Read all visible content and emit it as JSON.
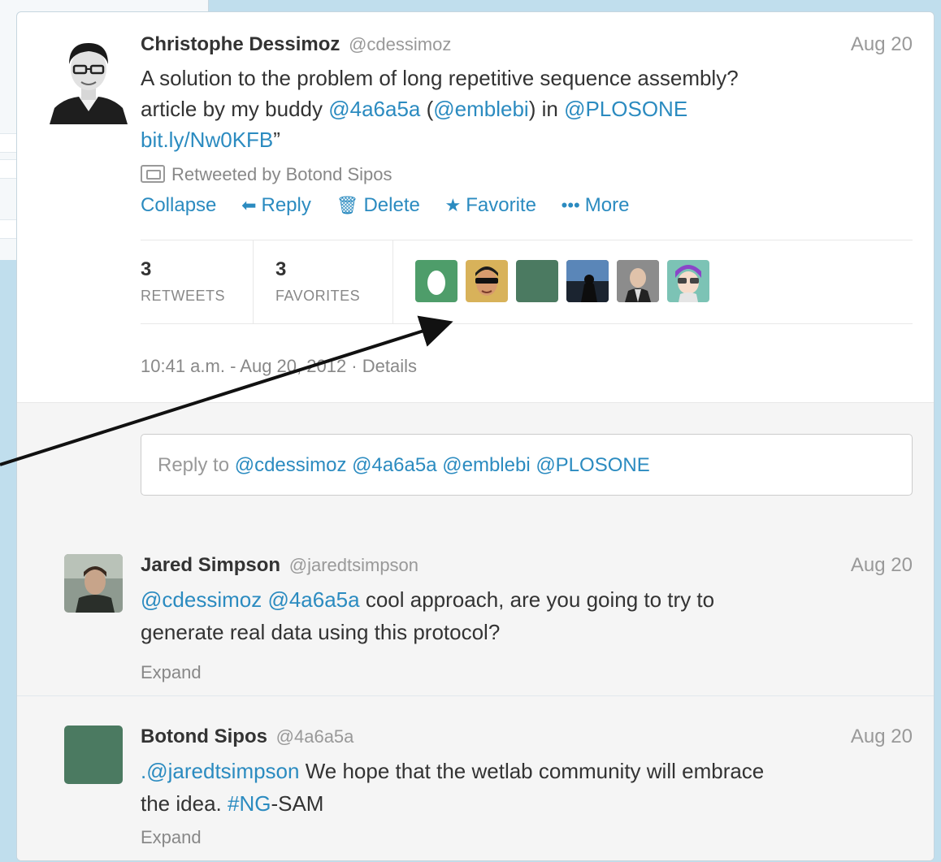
{
  "tweet": {
    "name": "Christophe Dessimoz",
    "handle": "@cdessimoz",
    "date": "Aug 20",
    "text_1": "A solution to the problem of long repetitive sequence assembly?",
    "text_2a": "article by my buddy ",
    "mention_1": "@4a6a5a",
    "text_2b": " (",
    "mention_2": "@emblebi",
    "text_2c": ") in ",
    "mention_3": "@PLOSONE",
    "link": "bit.ly/Nw0KFB",
    "quote_end": "”",
    "retweeted_by": "Retweeted by Botond Sipos",
    "actions": {
      "collapse": "Collapse",
      "reply": "Reply",
      "delete": "Delete",
      "favorite": "Favorite",
      "more": "More"
    },
    "stats": {
      "retweets_count": "3",
      "retweets_label": "RETWEETS",
      "favorites_count": "3",
      "favorites_label": "FAVORITES"
    },
    "faces": [
      {
        "name": "egg-avatar",
        "color": "#4e9d6a"
      },
      {
        "name": "sunglasses-avatar",
        "color": "#d8b25a"
      },
      {
        "name": "green-square-avatar",
        "color": "#4b7a61"
      },
      {
        "name": "night-photo-avatar",
        "color": "#2c3c4f"
      },
      {
        "name": "suit-avatar",
        "color": "#6a6a6a"
      },
      {
        "name": "cartoon-avatar",
        "color": "#7cc3b5"
      }
    ],
    "timestamp": "10:41 a.m. - Aug 20, 2012 · Details"
  },
  "reply_box": {
    "prefix": "Reply to ",
    "mentions": "@cdessimoz @4a6a5a @emblebi @PLOSONE"
  },
  "replies": [
    {
      "name": "Jared Simpson",
      "handle": "@jaredtsimpson",
      "date": "Aug 20",
      "mention_a": "@cdessimoz",
      "mention_b": "@4a6a5a",
      "text_a": " cool approach, are you going to try to",
      "text_b": "generate real data using this protocol?",
      "expand": "Expand"
    },
    {
      "name": "Botond Sipos",
      "handle": "@4a6a5a",
      "date": "Aug 20",
      "dot": ".",
      "mention": "@jaredtsimpson",
      "text_a": " We hope that the wetlab community will embrace",
      "text_b": "the idea. ",
      "hashtag": "#NG",
      "text_c": "-SAM",
      "expand": "Expand"
    }
  ],
  "colors": {
    "link": "#2b8bc0",
    "background": "#c0deed",
    "card": "#ffffff",
    "reply_bg": "#f5f5f5",
    "avatar_green": "#4b7a61"
  }
}
